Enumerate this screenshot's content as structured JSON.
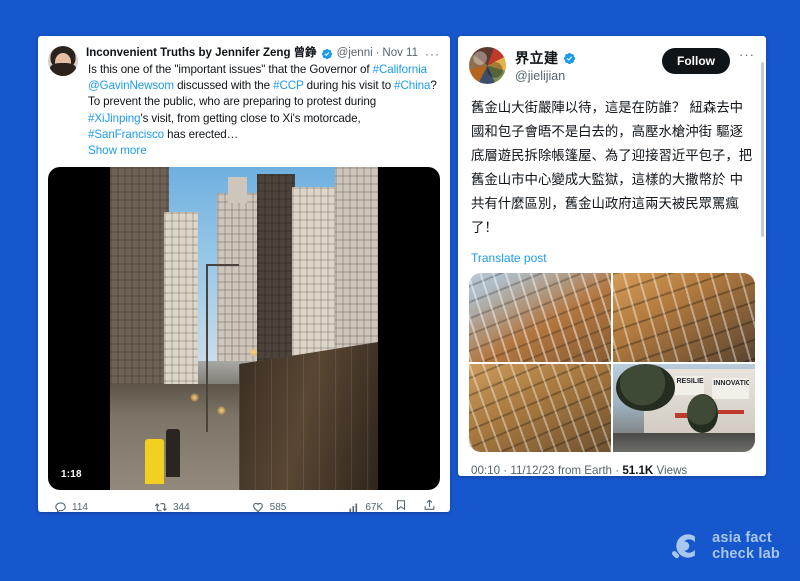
{
  "background_color": "#1757ce",
  "left_post": {
    "display_name": "Inconvenient Truths by Jennifer Zeng 曾錚",
    "verified_badge": "verified-badge-icon",
    "handle": "@jenniferzengS",
    "separator": "·",
    "date": "Nov 11",
    "more_menu": "···",
    "body_segments": [
      {
        "text": "Is this one of the \"important issues\" that the Governor of ",
        "link": false
      },
      {
        "text": "#California",
        "link": true
      },
      {
        "text": " ",
        "link": false
      },
      {
        "text": "@GavinNewsom",
        "link": true
      },
      {
        "text": " discussed with the ",
        "link": false
      },
      {
        "text": "#CCP",
        "link": true
      },
      {
        "text": " during his visit to ",
        "link": false
      },
      {
        "text": "#China",
        "link": true
      },
      {
        "text": "? To prevent the public, who are preparing to protest during ",
        "link": false
      },
      {
        "text": "#XiJinping",
        "link": true
      },
      {
        "text": "'s visit, from getting close to Xi's motorcade, ",
        "link": false
      },
      {
        "text": "#SanFrancisco",
        "link": true
      },
      {
        "text": " has erected…",
        "link": false
      }
    ],
    "show_more_label": "Show more",
    "video": {
      "duration_label": "1:18",
      "description": "City street with tall buildings and a tall metal barrier fence, people walking on sidewalk"
    },
    "actions": {
      "reply": {
        "icon": "reply-icon",
        "count": "114"
      },
      "repost": {
        "icon": "repost-icon",
        "count": "344"
      },
      "like": {
        "icon": "heart-icon",
        "count": "585"
      },
      "views": {
        "icon": "analytics-icon",
        "count": "67K"
      },
      "bookmark": {
        "icon": "bookmark-icon"
      },
      "share": {
        "icon": "share-icon"
      }
    }
  },
  "right_post": {
    "display_name": "界立建",
    "verified_badge": "verified-badge-icon",
    "handle": "@jielijian",
    "follow_label": "Follow",
    "more_menu": "···",
    "body": "舊金山大街嚴陣以待，這是在防誰？\n紐森去中國和包子會晤不是白去的，高壓水槍沖街 驅逐底層遊民拆除帳篷屋、為了迎接習近平包子，把舊金山市中心變成大監獄，這樣的大撒幣於 中共有什麼區別，舊金山政府這兩天被民眾罵瘋了！",
    "translate_label": "Translate post",
    "images": [
      {
        "alt": "Glass facade with metal barricade fence in front of apartment building"
      },
      {
        "alt": "Close-up of glass curtain wall reflecting golden sunset light"
      },
      {
        "alt": "Glass windows reflecting warm orange light at dusk"
      },
      {
        "alt": "Street view with large RESILIENCE and INNOVATION banners on building",
        "banner_text_1": "RESILIENCE",
        "banner_text_2": "INNOVATION"
      }
    ],
    "meta": {
      "time": "00:10",
      "separator": "·",
      "date": "11/12/23",
      "source": "from Earth",
      "views_count": "51.1K",
      "views_label": "Views"
    }
  },
  "watermark": {
    "icon": "magnifier-logo-icon",
    "line1": "asia fact",
    "line2": "check lab",
    "color": "#a9c6ee"
  }
}
